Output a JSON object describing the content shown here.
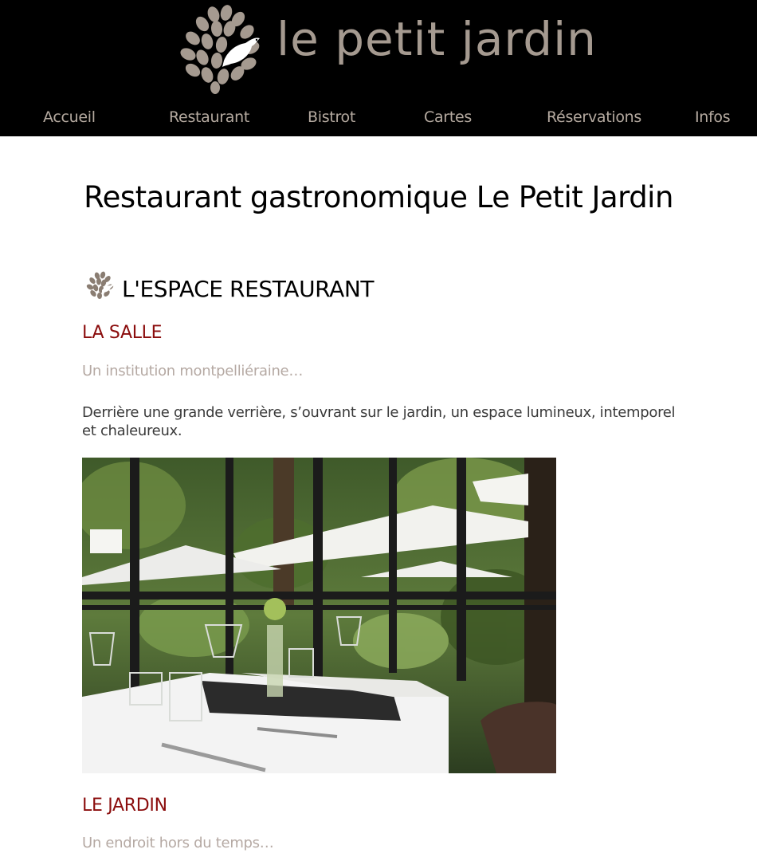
{
  "header": {
    "logo_text": "le petit jardin",
    "nav": [
      {
        "label": "Accueil"
      },
      {
        "label": "Restaurant"
      },
      {
        "label": "Bistrot"
      },
      {
        "label": "Cartes"
      },
      {
        "label": "Réservations"
      },
      {
        "label": "Infos"
      }
    ]
  },
  "page": {
    "title": "Restaurant gastronomique Le Petit Jardin"
  },
  "section": {
    "title": "L'ESPACE RESTAURANT",
    "icon": "leaf-cluster-icon",
    "salle": {
      "title": "LA SALLE",
      "tagline": "Un institution montpelliéraine…",
      "text": "Derrière une grande verrière, s’ouvrant sur le jardin, un espace lumineux, intemporel et chaleureux."
    },
    "jardin": {
      "title": "LE JARDIN",
      "tagline": "Un endroit hors du temps…"
    }
  },
  "colors": {
    "header_bg": "#000000",
    "nav_text": "#b5aaa0",
    "logo": "#a59a90",
    "subheading": "#8b0d0d",
    "tagline": "#b5a9a3"
  }
}
